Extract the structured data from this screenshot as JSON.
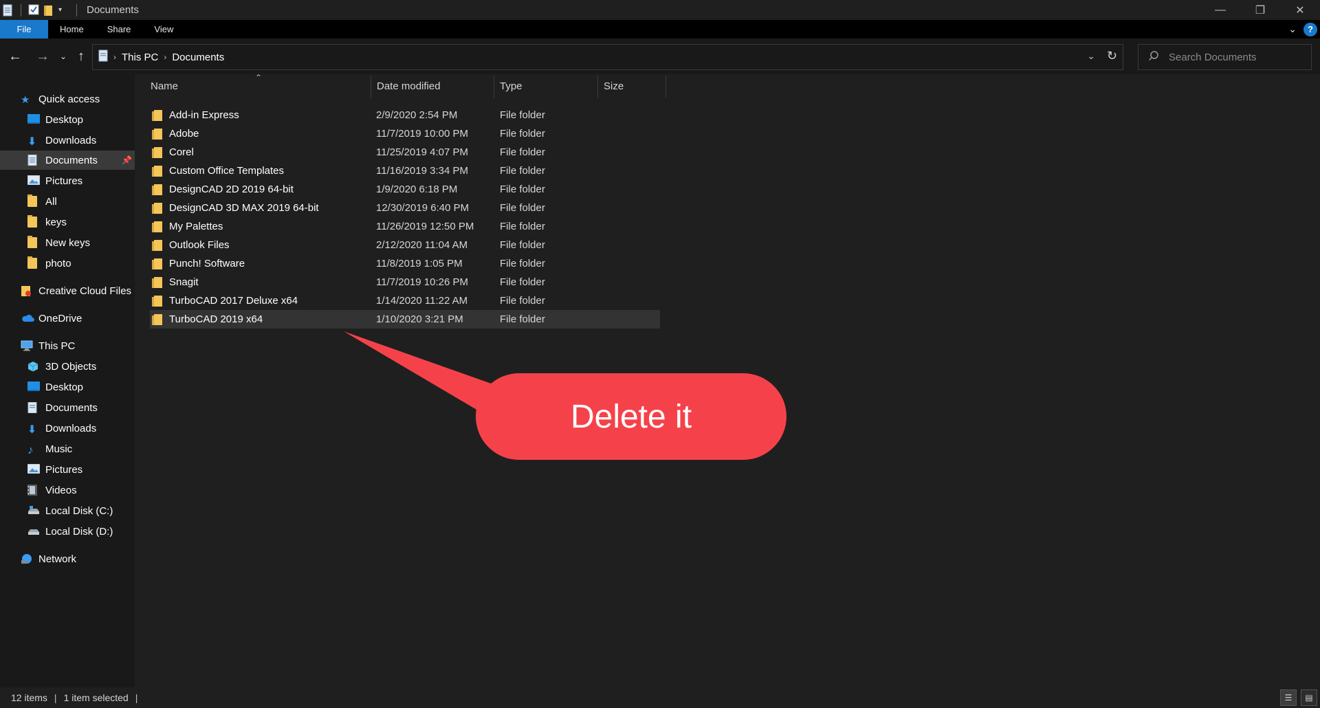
{
  "window": {
    "title": "Documents"
  },
  "ribbon": {
    "tabs": [
      "File",
      "Home",
      "Share",
      "View"
    ]
  },
  "address": {
    "crumbs": [
      "This PC",
      "Documents"
    ],
    "search_placeholder": "Search Documents"
  },
  "nav": {
    "quick_access": "Quick access",
    "qa_items": [
      "Desktop",
      "Downloads",
      "Documents",
      "Pictures",
      "All",
      "keys",
      "New keys",
      "photo"
    ],
    "creative_cloud": "Creative Cloud Files",
    "onedrive": "OneDrive",
    "this_pc": "This PC",
    "pc_items": [
      "3D Objects",
      "Desktop",
      "Documents",
      "Downloads",
      "Music",
      "Pictures",
      "Videos",
      "Local Disk (C:)",
      "Local Disk (D:)"
    ],
    "network": "Network"
  },
  "columns": {
    "name": "Name",
    "date": "Date modified",
    "type": "Type",
    "size": "Size"
  },
  "files": [
    {
      "name": "Add-in Express",
      "date": "2/9/2020 2:54 PM",
      "type": "File folder"
    },
    {
      "name": "Adobe",
      "date": "11/7/2019 10:00 PM",
      "type": "File folder"
    },
    {
      "name": "Corel",
      "date": "11/25/2019 4:07 PM",
      "type": "File folder"
    },
    {
      "name": "Custom Office Templates",
      "date": "11/16/2019 3:34 PM",
      "type": "File folder"
    },
    {
      "name": "DesignCAD 2D 2019 64-bit",
      "date": "1/9/2020 6:18 PM",
      "type": "File folder"
    },
    {
      "name": "DesignCAD 3D MAX 2019 64-bit",
      "date": "12/30/2019 6:40 PM",
      "type": "File folder"
    },
    {
      "name": "My Palettes",
      "date": "11/26/2019 12:50 PM",
      "type": "File folder"
    },
    {
      "name": "Outlook Files",
      "date": "2/12/2020 11:04 AM",
      "type": "File folder"
    },
    {
      "name": "Punch! Software",
      "date": "11/8/2019 1:05 PM",
      "type": "File folder"
    },
    {
      "name": "Snagit",
      "date": "11/7/2019 10:26 PM",
      "type": "File folder"
    },
    {
      "name": "TurboCAD 2017 Deluxe x64",
      "date": "1/14/2020 11:22 AM",
      "type": "File folder"
    },
    {
      "name": "TurboCAD 2019 x64",
      "date": "1/10/2020 3:21 PM",
      "type": "File folder"
    }
  ],
  "callout": {
    "text": "Delete it",
    "color": "#f5424a"
  },
  "status": {
    "items": "12 items",
    "selected": "1 item selected"
  },
  "colors": {
    "accent": "#1979ca",
    "folder": "#f4c65a",
    "selection": "#333333"
  }
}
